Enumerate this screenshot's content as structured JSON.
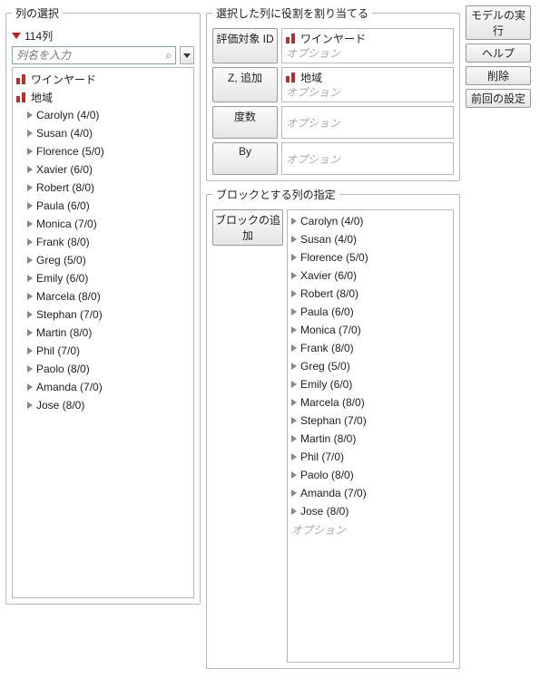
{
  "left": {
    "legend": "列の選択",
    "count_label": "114列",
    "search_placeholder": "列名を入力",
    "cols": [
      {
        "kind": "bars",
        "label": "ワインヤード"
      },
      {
        "kind": "bars",
        "label": "地域"
      },
      {
        "kind": "tri",
        "label": "Carolyn (4/0)"
      },
      {
        "kind": "tri",
        "label": "Susan (4/0)"
      },
      {
        "kind": "tri",
        "label": "Florence (5/0)"
      },
      {
        "kind": "tri",
        "label": "Xavier (6/0)"
      },
      {
        "kind": "tri",
        "label": "Robert (8/0)"
      },
      {
        "kind": "tri",
        "label": "Paula (6/0)"
      },
      {
        "kind": "tri",
        "label": "Monica (7/0)"
      },
      {
        "kind": "tri",
        "label": "Frank (8/0)"
      },
      {
        "kind": "tri",
        "label": "Greg (5/0)"
      },
      {
        "kind": "tri",
        "label": "Emily (6/0)"
      },
      {
        "kind": "tri",
        "label": "Marcela (8/0)"
      },
      {
        "kind": "tri",
        "label": "Stephan (7/0)"
      },
      {
        "kind": "tri",
        "label": "Martin (8/0)"
      },
      {
        "kind": "tri",
        "label": "Phil (7/0)"
      },
      {
        "kind": "tri",
        "label": "Paolo (8/0)"
      },
      {
        "kind": "tri",
        "label": "Amanda (7/0)"
      },
      {
        "kind": "tri",
        "label": "Jose (8/0)"
      }
    ]
  },
  "roles": {
    "legend": "選択した列に役割を割り当てる",
    "option_text": "オプション",
    "rows": [
      {
        "btn": "評価対象 ID",
        "value": "ワインヤード",
        "value_icon": "bars"
      },
      {
        "btn": "Z, 追加",
        "value": "地域",
        "value_icon": "bars"
      },
      {
        "btn": "度数",
        "value": null,
        "value_icon": null
      },
      {
        "btn": "By",
        "value": null,
        "value_icon": null
      }
    ]
  },
  "blocks": {
    "legend": "ブロックとする列の指定",
    "btn": "ブロックの追加",
    "option_text": "オプション",
    "items": [
      "Carolyn (4/0)",
      "Susan (4/0)",
      "Florence (5/0)",
      "Xavier (6/0)",
      "Robert (8/0)",
      "Paula (6/0)",
      "Monica (7/0)",
      "Frank (8/0)",
      "Greg (5/0)",
      "Emily (6/0)",
      "Marcela (8/0)",
      "Stephan (7/0)",
      "Martin (8/0)",
      "Phil (7/0)",
      "Paolo (8/0)",
      "Amanda (7/0)",
      "Jose (8/0)"
    ]
  },
  "actions": {
    "run": "モデルの実行",
    "help": "ヘルプ",
    "del": "削除",
    "prev": "前回の設定"
  }
}
